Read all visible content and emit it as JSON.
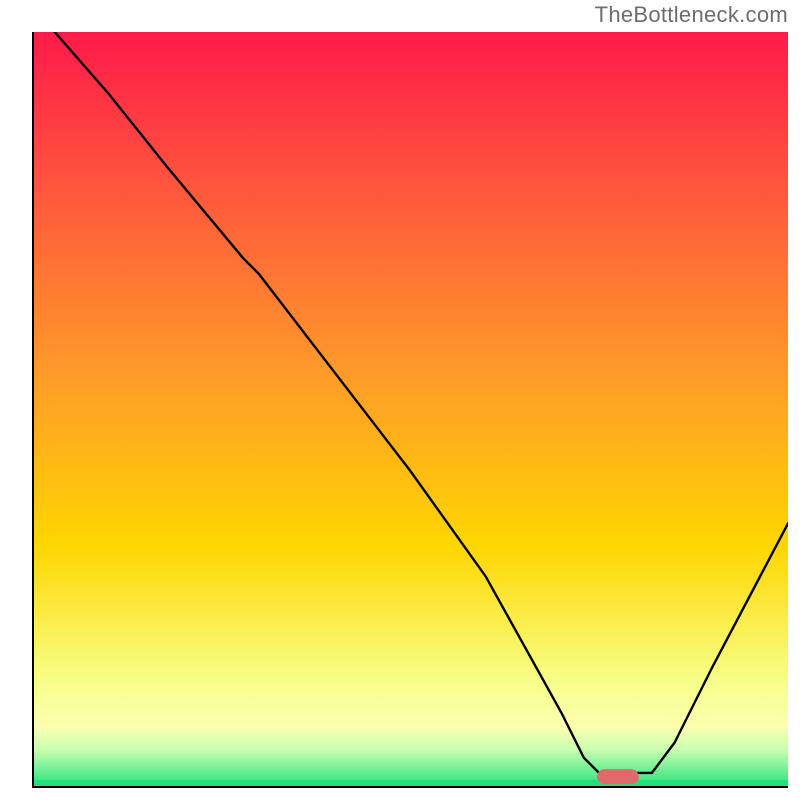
{
  "watermark": "TheBottleneck.com",
  "chart_data": {
    "type": "line",
    "title": "",
    "xlabel": "",
    "ylabel": "",
    "x_range": [
      0,
      100
    ],
    "y_range": [
      0,
      100
    ],
    "grid": false,
    "legend": false,
    "background_gradient": {
      "top": "#ff1a4a",
      "middle": "#ffd600",
      "lower": "#f7ff8a",
      "band_light_yellow": "#fbffb0",
      "bottom_green": "#21e07a"
    },
    "series": [
      {
        "name": "curve",
        "color": "#000000",
        "x": [
          3,
          10,
          18,
          28,
          30,
          40,
          50,
          60,
          70,
          73,
          75,
          80,
          82,
          85,
          90,
          100
        ],
        "y": [
          100,
          92,
          82,
          70,
          68,
          55,
          42,
          28,
          10,
          4,
          2,
          2,
          2,
          6,
          16,
          35
        ]
      }
    ],
    "marker": {
      "name": "optimal-marker",
      "color": "#e06a6a",
      "x": 77.5,
      "y": 1.5,
      "width_pct": 5.5,
      "height_pct": 2
    },
    "axes": {
      "stroke": "#000000",
      "x_axis_y": 0,
      "y_axis_x": 0
    }
  }
}
